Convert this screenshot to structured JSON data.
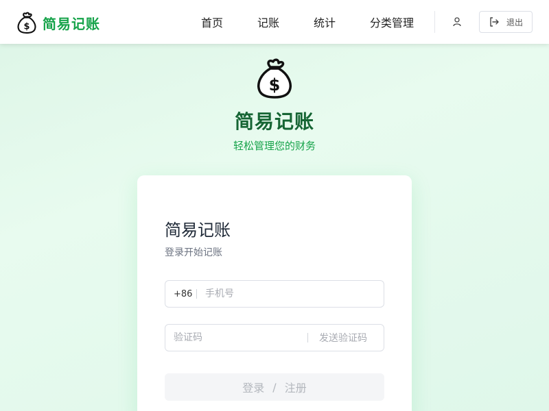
{
  "brand": {
    "name": "简易记账",
    "icon": "money-bag-icon",
    "color": "#16a34a"
  },
  "nav": {
    "items": [
      {
        "label": "首页"
      },
      {
        "label": "记账"
      },
      {
        "label": "统计"
      },
      {
        "label": "分类管理"
      }
    ],
    "user_icon": "user-icon",
    "logout_label": "退出",
    "logout_icon": "logout-icon"
  },
  "hero": {
    "title": "简易记账",
    "subtitle": "轻松管理您的财务",
    "title_color": "#166534",
    "subtitle_color": "#16a34a"
  },
  "login_card": {
    "title": "简易记账",
    "subtitle": "登录开始记账",
    "phone_prefix": "+86",
    "phone_placeholder": "手机号",
    "code_placeholder": "验证码",
    "send_code_label": "发送验证码",
    "submit_login": "登录",
    "submit_separator": "/",
    "submit_register": "注册"
  }
}
